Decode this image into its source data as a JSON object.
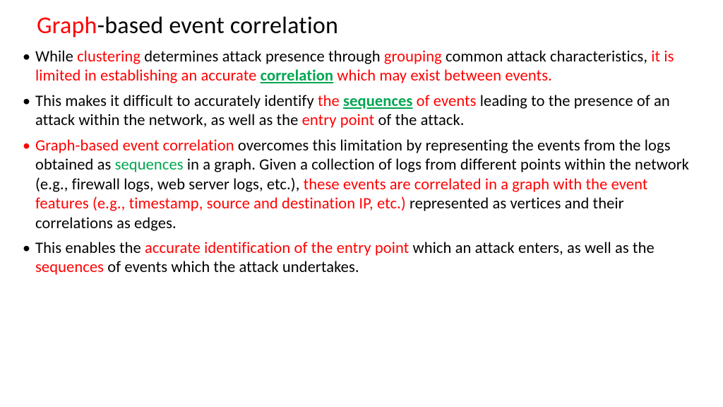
{
  "title": {
    "red": "Graph",
    "rest": "-based event correlation"
  },
  "bullets": {
    "b1": {
      "t1": "While ",
      "t2": "clustering",
      "t3": " determines attack presence through ",
      "t4": "grouping",
      "t5": " common attack characteristics, ",
      "t6": "it is limited in establishing an accurate ",
      "t7": "correlation",
      "t8": " which may exist between events."
    },
    "b2": {
      "t1": "This makes it difficult to accurately identify ",
      "t2": "the ",
      "t3": "sequences",
      "t4": " of events",
      "t5": " leading to the presence of an attack within the network, as well as the ",
      "t6": "entry point",
      "t7": " of the attack."
    },
    "b3": {
      "t1": "Graph-based event correlation",
      "t2": " overcomes this limitation by representing the events from the logs obtained as ",
      "t3": "sequences",
      "t4": " in a graph. Given a collection of logs from different points within the network (e.g., firewall logs, web server logs, etc.), ",
      "t5": "these events are correlated in a graph with the event features (e.g., timestamp, source and destination IP, etc.)",
      "t6": " represented as vertices and their correlations as edges."
    },
    "b4": {
      "t1": "This enables the ",
      "t2": "accurate identification of the entry point",
      "t3": " which an attack enters, as well as the ",
      "t4": "sequences",
      "t5": " of events which the attack undertakes."
    }
  }
}
